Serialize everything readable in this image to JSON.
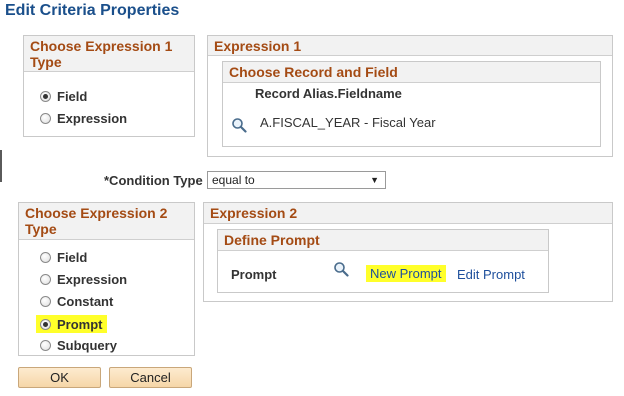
{
  "title": "Edit Criteria Properties",
  "expr1_type": {
    "header": "Choose Expression 1 Type",
    "options": [
      {
        "label": "Field",
        "checked": true
      },
      {
        "label": "Expression",
        "checked": false
      }
    ]
  },
  "expr1": {
    "header": "Expression 1",
    "choose_header": "Choose Record and Field",
    "column_header": "Record Alias.Fieldname",
    "field_value": "A.FISCAL_YEAR - Fiscal Year",
    "lookup_icon": "search-icon"
  },
  "condition": {
    "label": "*Condition Type",
    "selected": "equal to"
  },
  "expr2_type": {
    "header": "Choose Expression 2 Type",
    "options": [
      {
        "label": "Field",
        "checked": false
      },
      {
        "label": "Expression",
        "checked": false
      },
      {
        "label": "Constant",
        "checked": false
      },
      {
        "label": "Prompt",
        "checked": true,
        "highlighted": true
      },
      {
        "label": "Subquery",
        "checked": false
      }
    ]
  },
  "expr2": {
    "header": "Expression 2",
    "define_header": "Define Prompt",
    "prompt_label": "Prompt",
    "lookup_icon": "search-icon",
    "new_prompt": "New Prompt",
    "edit_prompt": "Edit Prompt"
  },
  "buttons": {
    "ok": "OK",
    "cancel": "Cancel"
  },
  "colors": {
    "title": "#1a4f8b",
    "section_header": "#a44b14",
    "highlight": "#ffff2a",
    "link": "#1e4f9c"
  }
}
